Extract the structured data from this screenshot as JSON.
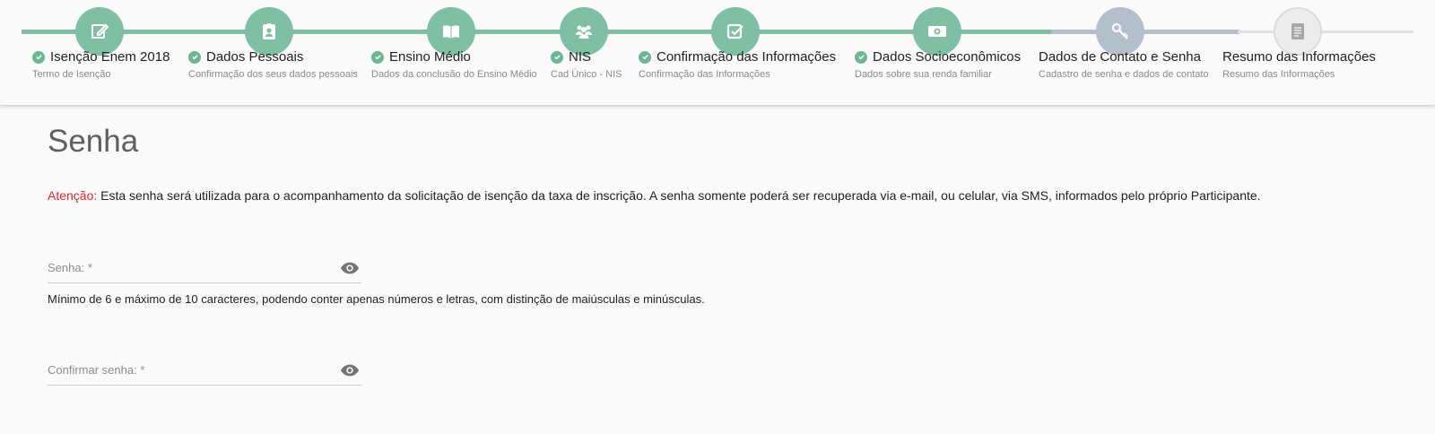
{
  "stepper": {
    "steps": [
      {
        "title": "Isenção Enem 2018",
        "subtitle": "Termo de Isenção",
        "status": "done",
        "icon": "edit-icon"
      },
      {
        "title": "Dados Pessoais",
        "subtitle": "Confirmação dos seus dados pessoais",
        "status": "done",
        "icon": "id-badge-icon"
      },
      {
        "title": "Ensino Médio",
        "subtitle": "Dados da conclusão do Ensino Médio",
        "status": "done",
        "icon": "book-icon"
      },
      {
        "title": "NIS",
        "subtitle": "Cad Único - NIS",
        "status": "done",
        "icon": "people-icon"
      },
      {
        "title": "Confirmação das Informações",
        "subtitle": "Confirmação das Informações",
        "status": "done",
        "icon": "checkbox-icon"
      },
      {
        "title": "Dados Socioeconômicos",
        "subtitle": "Dados sobre sua renda familiar",
        "status": "done",
        "icon": "money-icon"
      },
      {
        "title": "Dados de Contato e Senha",
        "subtitle": "Cadastro de senha e dados de contato",
        "status": "active",
        "icon": "key-icon"
      },
      {
        "title": "Resumo das Informações",
        "subtitle": "Resumo das Informações",
        "status": "pending",
        "icon": "document-icon"
      }
    ],
    "colors": {
      "done": "#7fbfa3",
      "active": "#b3c0cc",
      "pending": "#ececec"
    }
  },
  "form": {
    "title": "Senha",
    "notice_label": "Atenção:",
    "notice_text": "Esta senha será utilizada para o acompanhamento da solicitação de isenção da taxa de inscrição. A senha somente poderá ser recuperada via e-mail, ou celular, via SMS, informados pelo próprio Participante.",
    "password_placeholder": "Senha: *",
    "password_hint": "Mínimo de 6 e máximo de 10 caracteres, podendo conter apenas números e letras, com distinção de maiúsculas e minúsculas.",
    "confirm_placeholder": "Confirmar senha: *"
  }
}
